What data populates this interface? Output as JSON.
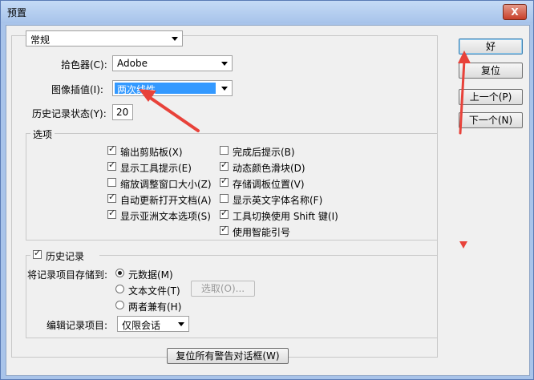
{
  "window": {
    "title": "预置",
    "close_glyph": "X"
  },
  "top": {
    "category_value": "常规",
    "color_picker_label": "拾色器(C):",
    "color_picker_value": "Adobe",
    "interp_label": "图像插值(I):",
    "interp_value": "两次线性",
    "history_states_label": "历史记录状态(Y):",
    "history_states_value": "20"
  },
  "options": {
    "title": "选项",
    "left": [
      {
        "label": "输出剪贴板(X)",
        "checked": true
      },
      {
        "label": "显示工具提示(E)",
        "checked": true
      },
      {
        "label": "缩放调整窗口大小(Z)",
        "checked": false
      },
      {
        "label": "自动更新打开文档(A)",
        "checked": true
      },
      {
        "label": "显示亚洲文本选项(S)",
        "checked": true
      }
    ],
    "right": [
      {
        "label": "完成后提示(B)",
        "checked": false
      },
      {
        "label": "动态颜色滑块(D)",
        "checked": true
      },
      {
        "label": "存储调板位置(V)",
        "checked": true
      },
      {
        "label": "显示英文字体名称(F)",
        "checked": false
      },
      {
        "label": "工具切换使用 Shift 键(I)",
        "checked": true
      },
      {
        "label": "使用智能引号",
        "checked": true
      }
    ]
  },
  "history": {
    "title": "历史记录",
    "enabled": true,
    "save_to_label": "将记录项目存储到:",
    "radios": [
      {
        "label": "元数据(M)",
        "selected": true
      },
      {
        "label": "文本文件(T)",
        "selected": false
      },
      {
        "label": "两者兼有(H)",
        "selected": false
      }
    ],
    "choose_label": "选取(O)...",
    "edit_items_label": "编辑记录项目:",
    "edit_items_value": "仅限会话"
  },
  "reset_warnings_label": "复位所有警告对话框(W)",
  "side_buttons": {
    "ok": "好",
    "reset": "复位",
    "prev": "上一个(P)",
    "next": "下一个(N)"
  },
  "colors": {
    "annotation_arrow": "#e8423a",
    "selection": "#3399ff",
    "title_bar": "#a9c4ea"
  }
}
